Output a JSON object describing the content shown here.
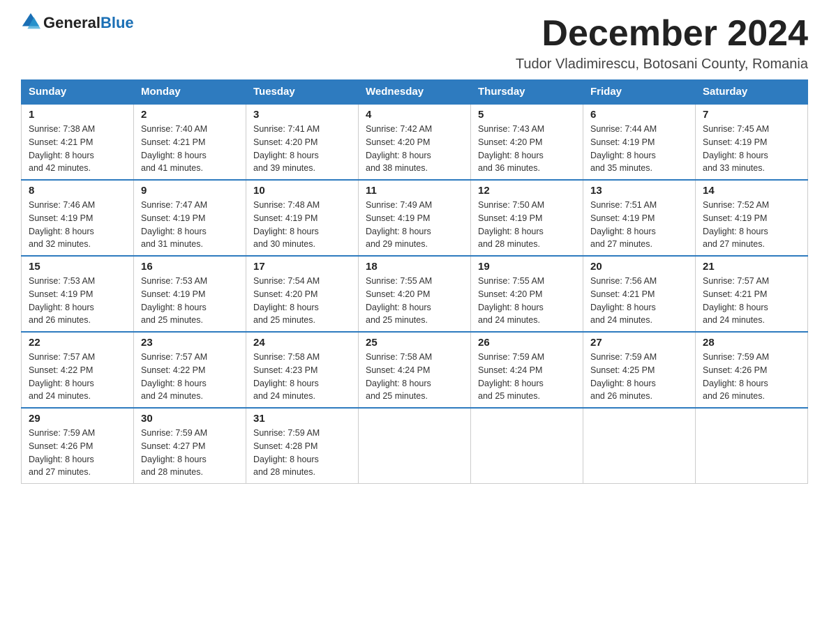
{
  "header": {
    "logo_general": "General",
    "logo_blue": "Blue",
    "month_title": "December 2024",
    "location": "Tudor Vladimirescu, Botosani County, Romania"
  },
  "weekdays": [
    "Sunday",
    "Monday",
    "Tuesday",
    "Wednesday",
    "Thursday",
    "Friday",
    "Saturday"
  ],
  "weeks": [
    [
      {
        "day": "1",
        "sunrise": "7:38 AM",
        "sunset": "4:21 PM",
        "daylight": "8 hours and 42 minutes."
      },
      {
        "day": "2",
        "sunrise": "7:40 AM",
        "sunset": "4:21 PM",
        "daylight": "8 hours and 41 minutes."
      },
      {
        "day": "3",
        "sunrise": "7:41 AM",
        "sunset": "4:20 PM",
        "daylight": "8 hours and 39 minutes."
      },
      {
        "day": "4",
        "sunrise": "7:42 AM",
        "sunset": "4:20 PM",
        "daylight": "8 hours and 38 minutes."
      },
      {
        "day": "5",
        "sunrise": "7:43 AM",
        "sunset": "4:20 PM",
        "daylight": "8 hours and 36 minutes."
      },
      {
        "day": "6",
        "sunrise": "7:44 AM",
        "sunset": "4:19 PM",
        "daylight": "8 hours and 35 minutes."
      },
      {
        "day": "7",
        "sunrise": "7:45 AM",
        "sunset": "4:19 PM",
        "daylight": "8 hours and 33 minutes."
      }
    ],
    [
      {
        "day": "8",
        "sunrise": "7:46 AM",
        "sunset": "4:19 PM",
        "daylight": "8 hours and 32 minutes."
      },
      {
        "day": "9",
        "sunrise": "7:47 AM",
        "sunset": "4:19 PM",
        "daylight": "8 hours and 31 minutes."
      },
      {
        "day": "10",
        "sunrise": "7:48 AM",
        "sunset": "4:19 PM",
        "daylight": "8 hours and 30 minutes."
      },
      {
        "day": "11",
        "sunrise": "7:49 AM",
        "sunset": "4:19 PM",
        "daylight": "8 hours and 29 minutes."
      },
      {
        "day": "12",
        "sunrise": "7:50 AM",
        "sunset": "4:19 PM",
        "daylight": "8 hours and 28 minutes."
      },
      {
        "day": "13",
        "sunrise": "7:51 AM",
        "sunset": "4:19 PM",
        "daylight": "8 hours and 27 minutes."
      },
      {
        "day": "14",
        "sunrise": "7:52 AM",
        "sunset": "4:19 PM",
        "daylight": "8 hours and 27 minutes."
      }
    ],
    [
      {
        "day": "15",
        "sunrise": "7:53 AM",
        "sunset": "4:19 PM",
        "daylight": "8 hours and 26 minutes."
      },
      {
        "day": "16",
        "sunrise": "7:53 AM",
        "sunset": "4:19 PM",
        "daylight": "8 hours and 25 minutes."
      },
      {
        "day": "17",
        "sunrise": "7:54 AM",
        "sunset": "4:20 PM",
        "daylight": "8 hours and 25 minutes."
      },
      {
        "day": "18",
        "sunrise": "7:55 AM",
        "sunset": "4:20 PM",
        "daylight": "8 hours and 25 minutes."
      },
      {
        "day": "19",
        "sunrise": "7:55 AM",
        "sunset": "4:20 PM",
        "daylight": "8 hours and 24 minutes."
      },
      {
        "day": "20",
        "sunrise": "7:56 AM",
        "sunset": "4:21 PM",
        "daylight": "8 hours and 24 minutes."
      },
      {
        "day": "21",
        "sunrise": "7:57 AM",
        "sunset": "4:21 PM",
        "daylight": "8 hours and 24 minutes."
      }
    ],
    [
      {
        "day": "22",
        "sunrise": "7:57 AM",
        "sunset": "4:22 PM",
        "daylight": "8 hours and 24 minutes."
      },
      {
        "day": "23",
        "sunrise": "7:57 AM",
        "sunset": "4:22 PM",
        "daylight": "8 hours and 24 minutes."
      },
      {
        "day": "24",
        "sunrise": "7:58 AM",
        "sunset": "4:23 PM",
        "daylight": "8 hours and 24 minutes."
      },
      {
        "day": "25",
        "sunrise": "7:58 AM",
        "sunset": "4:24 PM",
        "daylight": "8 hours and 25 minutes."
      },
      {
        "day": "26",
        "sunrise": "7:59 AM",
        "sunset": "4:24 PM",
        "daylight": "8 hours and 25 minutes."
      },
      {
        "day": "27",
        "sunrise": "7:59 AM",
        "sunset": "4:25 PM",
        "daylight": "8 hours and 26 minutes."
      },
      {
        "day": "28",
        "sunrise": "7:59 AM",
        "sunset": "4:26 PM",
        "daylight": "8 hours and 26 minutes."
      }
    ],
    [
      {
        "day": "29",
        "sunrise": "7:59 AM",
        "sunset": "4:26 PM",
        "daylight": "8 hours and 27 minutes."
      },
      {
        "day": "30",
        "sunrise": "7:59 AM",
        "sunset": "4:27 PM",
        "daylight": "8 hours and 28 minutes."
      },
      {
        "day": "31",
        "sunrise": "7:59 AM",
        "sunset": "4:28 PM",
        "daylight": "8 hours and 28 minutes."
      },
      null,
      null,
      null,
      null
    ]
  ],
  "labels": {
    "sunrise_prefix": "Sunrise: ",
    "sunset_prefix": "Sunset: ",
    "daylight_prefix": "Daylight: "
  }
}
